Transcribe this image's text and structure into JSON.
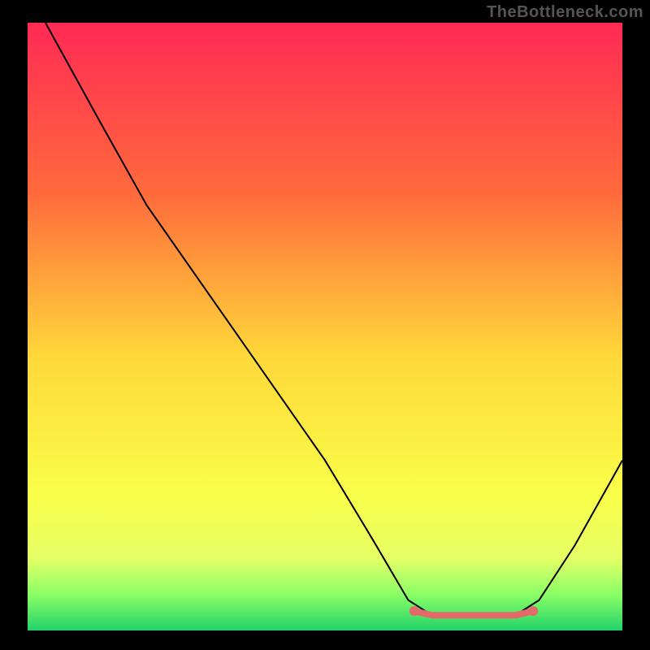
{
  "watermark": "TheBottleneck.com",
  "chart_data": {
    "type": "line",
    "title": "",
    "xlabel": "",
    "ylabel": "",
    "xlim": [
      0,
      100
    ],
    "ylim": [
      0,
      100
    ],
    "grid": false,
    "legend": false,
    "plot_background": {
      "gradient_stops": [
        {
          "offset": 0,
          "color": "#ff2a55"
        },
        {
          "offset": 28,
          "color": "#ff6a3c"
        },
        {
          "offset": 55,
          "color": "#ffd83a"
        },
        {
          "offset": 78,
          "color": "#f9ff4a"
        },
        {
          "offset": 88,
          "color": "#e6ff66"
        },
        {
          "offset": 94,
          "color": "#8cff66"
        },
        {
          "offset": 100,
          "color": "#22d36a"
        }
      ]
    },
    "series": [
      {
        "name": "bottleneck-curve",
        "stroke": "#000000",
        "points": [
          {
            "x": 3,
            "y": 100
          },
          {
            "x": 12,
            "y": 84
          },
          {
            "x": 20,
            "y": 70
          },
          {
            "x": 35,
            "y": 49
          },
          {
            "x": 50,
            "y": 28
          },
          {
            "x": 58,
            "y": 15
          },
          {
            "x": 64,
            "y": 5
          },
          {
            "x": 68,
            "y": 2.5
          },
          {
            "x": 75,
            "y": 2.5
          },
          {
            "x": 82,
            "y": 2.5
          },
          {
            "x": 86,
            "y": 5
          },
          {
            "x": 92,
            "y": 14
          },
          {
            "x": 100,
            "y": 28
          }
        ]
      },
      {
        "name": "optimal-range-highlight",
        "stroke": "#e46a6a",
        "stroke_width": 8,
        "points": [
          {
            "x": 65,
            "y": 3.2
          },
          {
            "x": 68,
            "y": 2.5
          },
          {
            "x": 75,
            "y": 2.5
          },
          {
            "x": 82,
            "y": 2.5
          },
          {
            "x": 85,
            "y": 3.2
          }
        ]
      }
    ],
    "markers": [
      {
        "x": 65,
        "y": 3.2,
        "color": "#e46a6a",
        "r": 6
      },
      {
        "x": 85,
        "y": 3.2,
        "color": "#e46a6a",
        "r": 6
      }
    ]
  }
}
